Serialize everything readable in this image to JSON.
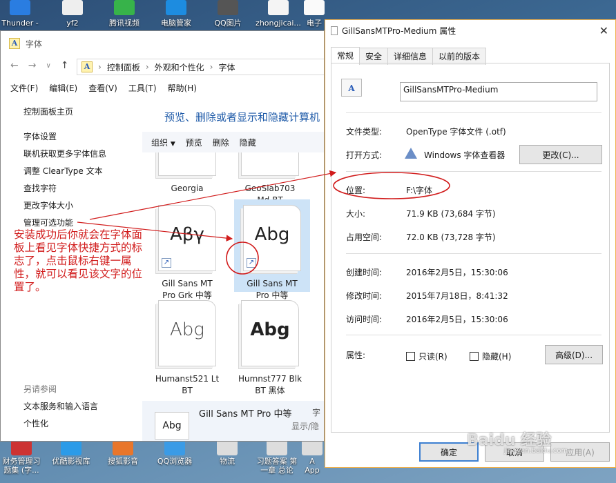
{
  "desktop_top": [
    "Thunder -",
    "yf2",
    "腾讯视频",
    "电脑管家",
    "QQ图片",
    "zhongjicai...",
    "电子"
  ],
  "desktop_bottom": [
    "财务管理习\n题集 (字...",
    "优酷影视库",
    "搜狐影音",
    "QQ浏览器",
    "物流",
    "习题答案 第\n一章 总论",
    "A\nApp"
  ],
  "explorer": {
    "title": "字体",
    "breadcrumb": [
      "控制面板",
      "外观和个性化",
      "字体"
    ],
    "menu": [
      "文件(F)",
      "编辑(E)",
      "查看(V)",
      "工具(T)",
      "帮助(H)"
    ],
    "left_links": [
      "控制面板主页",
      "字体设置",
      "联机获取更多字体信息",
      "调整 ClearType 文本",
      "查找字符",
      "更改字体大小",
      "管理可选功能"
    ],
    "see_also_label": "另请参阅",
    "see_also_links": [
      "文本服务和输入语言",
      "个性化"
    ],
    "heading": "预览、删除或者显示和隐藏计算机",
    "toolbar": {
      "organize": "组织",
      "preview": "预览",
      "delete": "删除",
      "hide": "隐藏"
    },
    "fonts": [
      {
        "name": "Georgia",
        "sample": ""
      },
      {
        "name": "GeoSlab703\nMd BT",
        "sample": ""
      },
      {
        "name": "Gill Sans MT\nPro Grk 中等",
        "sample": "Αβγ"
      },
      {
        "name": "Gill Sans MT\nPro 中等",
        "sample": "Abg"
      },
      {
        "name": "Humanst521 Lt\nBT",
        "sample": "Abg"
      },
      {
        "name": "Humnst777 Blk\nBT 黑体",
        "sample": "Abg"
      }
    ],
    "info": {
      "font_name": "Gill Sans MT Pro 中等",
      "sample": "Abg",
      "right1": "字",
      "right2": "显示/隐"
    }
  },
  "annotation": "安装成功后你就会在字体面板上看见字体快捷方式的标志了，点击鼠标右键一属性，就可以看见该文字的位置了。",
  "props": {
    "title": "GillSansMTPro-Medium 属性",
    "tabs": [
      "常规",
      "安全",
      "详细信息",
      "以前的版本"
    ],
    "name_value": "GillSansMTPro-Medium",
    "rows": {
      "type_label": "文件类型:",
      "type_value": "OpenType 字体文件 (.otf)",
      "open_label": "打开方式:",
      "open_value": "Windows 字体查看器",
      "change_btn": "更改(C)...",
      "loc_label": "位置:",
      "loc_value": "F:\\字体",
      "size_label": "大小:",
      "size_value": "71.9 KB (73,684 字节)",
      "disk_label": "占用空间:",
      "disk_value": "72.0 KB (73,728 字节)",
      "created_label": "创建时间:",
      "created_value": "2016年2月5日，15:30:06",
      "modified_label": "修改时间:",
      "modified_value": "2015年7月18日，8:41:32",
      "accessed_label": "访问时间:",
      "accessed_value": "2016年2月5日，15:30:06",
      "attr_label": "属性:",
      "readonly": "只读(R)",
      "hidden": "隐藏(H)",
      "advanced_btn": "高级(D)..."
    },
    "ok": "确定",
    "cancel": "取消",
    "apply": "应用(A)"
  },
  "watermark": "Baidu 经验",
  "watermark_url": "jingyan.baidu.com"
}
